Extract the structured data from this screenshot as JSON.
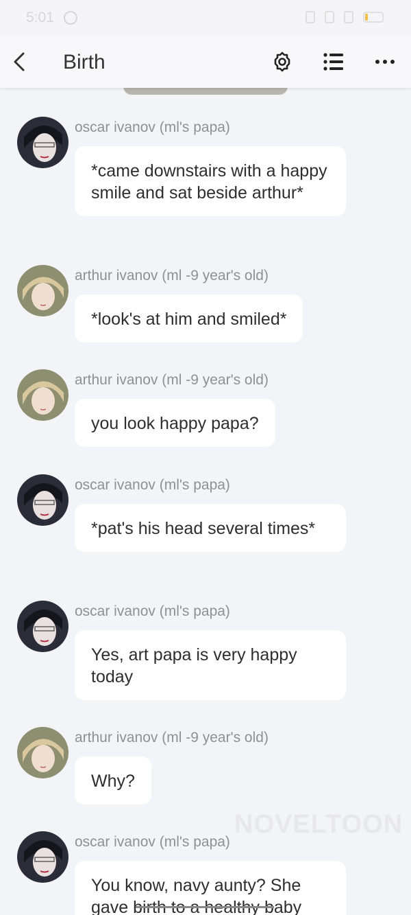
{
  "status_bar": {
    "time": "5:01"
  },
  "header": {
    "title": "Birth"
  },
  "icons": {
    "back": "back-arrow-icon",
    "settings": "gear-icon",
    "list": "list-icon",
    "more": "more-icon"
  },
  "messages": [
    {
      "sender": "oscar ivanov (ml's papa)",
      "text": "*came downstairs with a happy smile and sat beside arthur*",
      "avatar": "oscar"
    },
    {
      "sender": "arthur ivanov (ml -9 year's old)",
      "text": "*look's at him and smiled*",
      "avatar": "arthur"
    },
    {
      "sender": "arthur ivanov (ml -9 year's old)",
      "text": "you look happy papa?",
      "avatar": "arthur"
    },
    {
      "sender": "oscar ivanov (ml's papa)",
      "text": "*pat's his head several times*",
      "avatar": "oscar"
    },
    {
      "sender": "oscar ivanov (ml's papa)",
      "text": "Yes, art papa is very happy today",
      "avatar": "oscar"
    },
    {
      "sender": "arthur ivanov (ml -9 year's old)",
      "text": "Why?",
      "avatar": "arthur"
    },
    {
      "sender": "oscar ivanov (ml's papa)",
      "text": "You know, navy aunty? She gave birth to a healthy baby",
      "avatar": "oscar"
    }
  ],
  "watermark": "NOVELTOON",
  "colors": {
    "background": "#f3f4f8",
    "bubble": "#ffffff",
    "sender_text": "#909094",
    "message_text": "#2e2e2e"
  }
}
